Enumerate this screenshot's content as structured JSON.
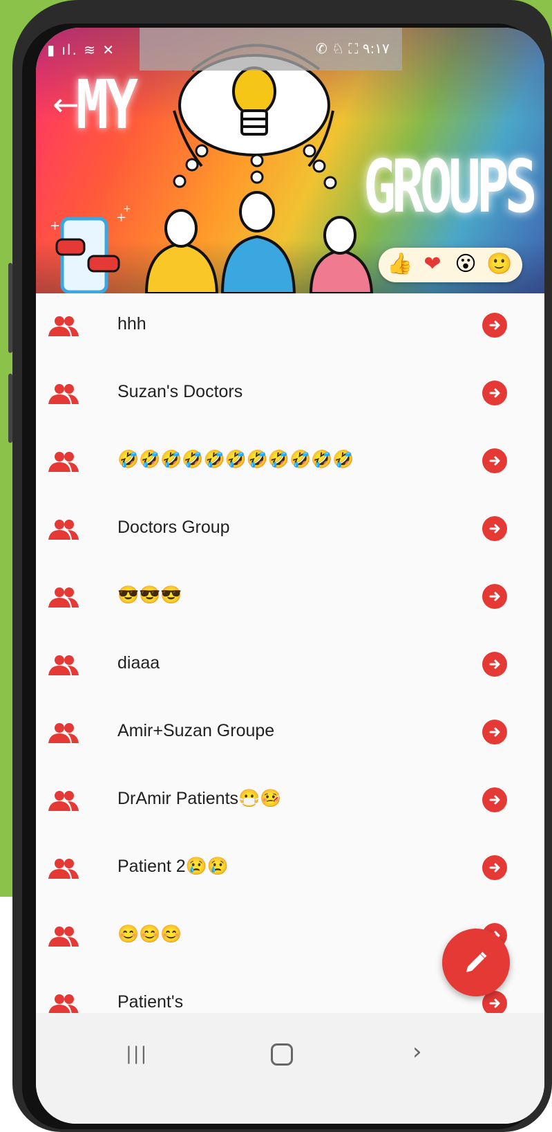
{
  "status_bar": {
    "left_icons": "▮ ıl. ≋ ✕",
    "right_icons": "✆ ♘ ⛶ ٩:١٧"
  },
  "header": {
    "back_icon": "←",
    "title_part1": "MY",
    "title_part2": "GROUPS",
    "reactions": [
      "👍",
      "❤",
      "😮",
      "🙂"
    ]
  },
  "groups": [
    {
      "name": "hhh"
    },
    {
      "name": "Suzan's Doctors"
    },
    {
      "name": "🤣🤣🤣🤣🤣🤣🤣🤣🤣🤣🤣"
    },
    {
      "name": "Doctors Group"
    },
    {
      "name": "😎😎😎"
    },
    {
      "name": "diaaa"
    },
    {
      "name": "Amir+Suzan Groupe"
    },
    {
      "name": "DrAmir Patients😷🤒"
    },
    {
      "name": "Patient 2😢😢"
    },
    {
      "name": "😊😊😊"
    },
    {
      "name": "Patient's"
    }
  ],
  "icons": {
    "group": "group-icon",
    "open": "arrow-right-circle-icon",
    "fab": "pencil-icon"
  },
  "colors": {
    "accent": "#e53935",
    "background_green": "#8bc34a",
    "list_background": "#fafafa"
  },
  "navbar": {
    "recents": "|||",
    "back": "›"
  }
}
